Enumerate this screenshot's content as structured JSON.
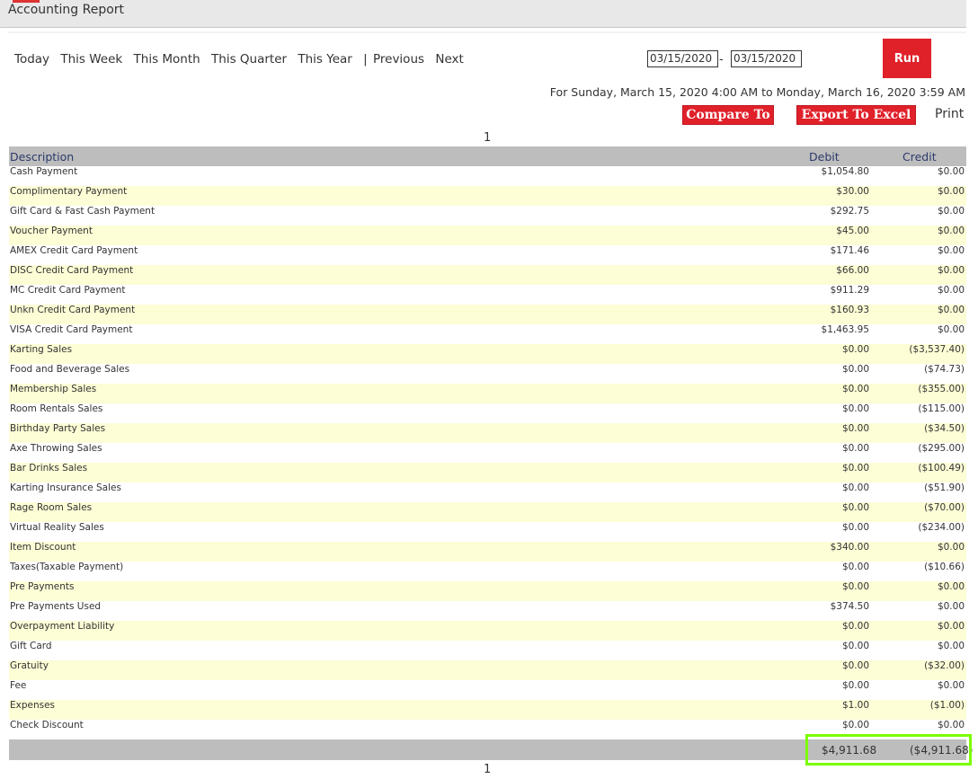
{
  "header": {
    "title": "Accounting Report"
  },
  "quick_ranges": [
    "Today",
    "This Week",
    "This Month",
    "This Quarter",
    "This Year"
  ],
  "nav": {
    "separator": "|",
    "previous": "Previous",
    "next": "Next"
  },
  "date_range": {
    "start": "03/15/2020",
    "end": "03/15/2020",
    "separator": "-"
  },
  "run_label": "Run",
  "range_text": "For Sunday, March 15, 2020 4:00 AM to Monday, March 16, 2020 3:59 AM",
  "actions": {
    "compare": "Compare To",
    "export": "Export To Excel",
    "print": "Print"
  },
  "page": "1",
  "table": {
    "headers": {
      "description": "Description",
      "debit": "Debit",
      "credit": "Credit"
    },
    "rows": [
      {
        "description": "Cash Payment",
        "debit": "$1,054.80",
        "credit": "$0.00"
      },
      {
        "description": "Complimentary Payment",
        "debit": "$30.00",
        "credit": "$0.00"
      },
      {
        "description": "Gift Card & Fast Cash Payment",
        "debit": "$292.75",
        "credit": "$0.00"
      },
      {
        "description": "Voucher Payment",
        "debit": "$45.00",
        "credit": "$0.00"
      },
      {
        "description": "AMEX Credit Card Payment",
        "debit": "$171.46",
        "credit": "$0.00"
      },
      {
        "description": "DISC Credit Card Payment",
        "debit": "$66.00",
        "credit": "$0.00"
      },
      {
        "description": "MC Credit Card Payment",
        "debit": "$911.29",
        "credit": "$0.00"
      },
      {
        "description": "Unkn Credit Card Payment",
        "debit": "$160.93",
        "credit": "$0.00"
      },
      {
        "description": "VISA Credit Card Payment",
        "debit": "$1,463.95",
        "credit": "$0.00"
      },
      {
        "description": "Karting Sales",
        "debit": "$0.00",
        "credit": "($3,537.40)"
      },
      {
        "description": "Food and Beverage Sales",
        "debit": "$0.00",
        "credit": "($74.73)"
      },
      {
        "description": "Membership Sales",
        "debit": "$0.00",
        "credit": "($355.00)"
      },
      {
        "description": "Room Rentals Sales",
        "debit": "$0.00",
        "credit": "($115.00)"
      },
      {
        "description": "Birthday Party Sales",
        "debit": "$0.00",
        "credit": "($34.50)"
      },
      {
        "description": "Axe Throwing Sales",
        "debit": "$0.00",
        "credit": "($295.00)"
      },
      {
        "description": "Bar Drinks Sales",
        "debit": "$0.00",
        "credit": "($100.49)"
      },
      {
        "description": "Karting Insurance Sales",
        "debit": "$0.00",
        "credit": "($51.90)"
      },
      {
        "description": "Rage Room Sales",
        "debit": "$0.00",
        "credit": "($70.00)"
      },
      {
        "description": "Virtual Reality Sales",
        "debit": "$0.00",
        "credit": "($234.00)"
      },
      {
        "description": "Item Discount",
        "debit": "$340.00",
        "credit": "$0.00"
      },
      {
        "description": "Taxes(Taxable Payment)",
        "debit": "$0.00",
        "credit": "($10.66)"
      },
      {
        "description": "Pre Payments",
        "debit": "$0.00",
        "credit": "$0.00"
      },
      {
        "description": "Pre Payments Used",
        "debit": "$374.50",
        "credit": "$0.00"
      },
      {
        "description": "Overpayment Liability",
        "debit": "$0.00",
        "credit": "$0.00"
      },
      {
        "description": "Gift Card",
        "debit": "$0.00",
        "credit": "$0.00"
      },
      {
        "description": "Gratuity",
        "debit": "$0.00",
        "credit": "($32.00)"
      },
      {
        "description": "Fee",
        "debit": "$0.00",
        "credit": "$0.00"
      },
      {
        "description": "Expenses",
        "debit": "$1.00",
        "credit": "($1.00)"
      },
      {
        "description": "Check Discount",
        "debit": "$0.00",
        "credit": "$0.00"
      }
    ],
    "totals": {
      "debit": "$4,911.68",
      "credit": "($4,911.68)"
    }
  },
  "colors": {
    "accent_red": "#e0212a",
    "header_gray": "#bdbdbd",
    "row_alt": "#fdfdd6",
    "highlight": "#7cfc00"
  }
}
